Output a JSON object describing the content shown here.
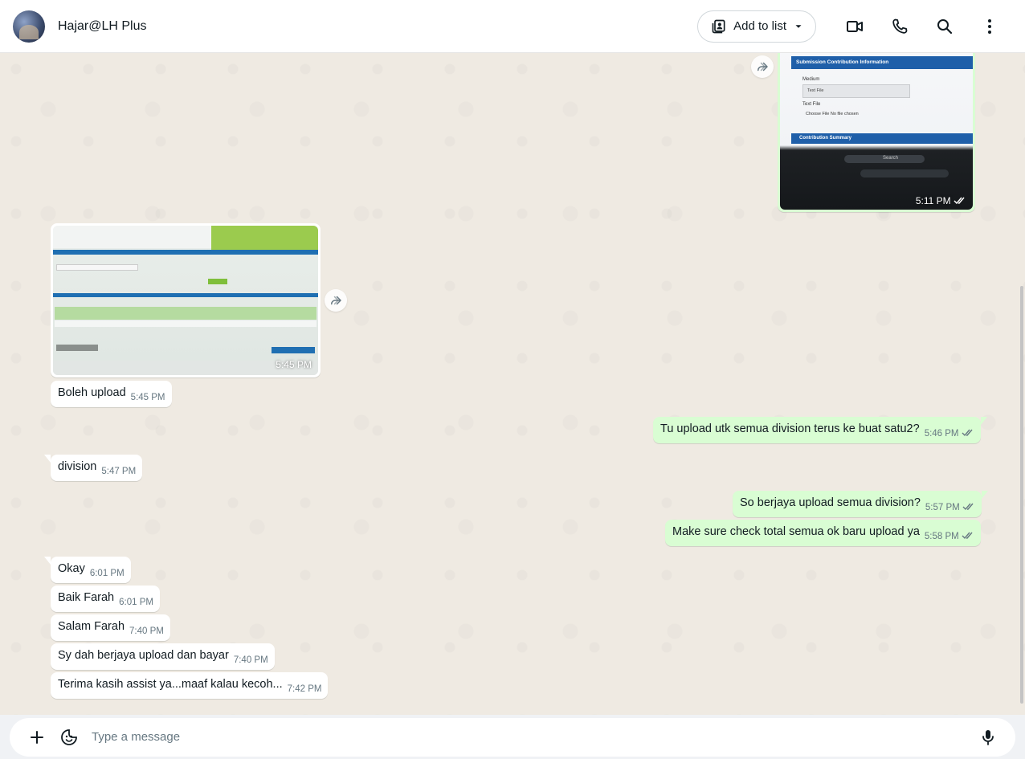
{
  "header": {
    "contact_name": "Hajar@LH Plus",
    "add_to_list_label": "Add to list",
    "icons": [
      "video-call-icon",
      "voice-call-icon",
      "search-icon",
      "menu-icon"
    ]
  },
  "images": {
    "sent_image_time": "5:11 PM",
    "received_image_time": "5:45 PM",
    "sent_image_lines": [
      "Submission Contribution Information",
      "Medium",
      "Text File",
      "Text File",
      "Choose File  No file chosen",
      "Contribution Summary",
      "Search"
    ]
  },
  "messages": [
    {
      "dir": "in",
      "text": "Boleh upload",
      "time": "5:45 PM"
    },
    {
      "dir": "out",
      "text": "Tu upload utk semua division terus ke buat satu2?",
      "time": "5:46 PM"
    },
    {
      "dir": "in",
      "text": "division",
      "time": "5:47 PM"
    },
    {
      "dir": "out",
      "text": "So berjaya upload semua division?",
      "time": "5:57 PM"
    },
    {
      "dir": "out",
      "text": "Make sure check total semua ok baru upload ya",
      "time": "5:58 PM"
    },
    {
      "dir": "in",
      "text": "Okay",
      "time": "6:01 PM"
    },
    {
      "dir": "in",
      "text": "Baik Farah",
      "time": "6:01 PM"
    },
    {
      "dir": "in",
      "text": "Salam Farah",
      "time": "7:40 PM"
    },
    {
      "dir": "in",
      "text": "Sy dah berjaya upload dan bayar",
      "time": "7:40 PM"
    },
    {
      "dir": "in",
      "text": "Terima kasih assist ya...maaf kalau kecoh...",
      "time": "7:42 PM"
    }
  ],
  "composer": {
    "placeholder": "Type a message"
  },
  "colors": {
    "chat_bg": "#efeae2",
    "incoming": "#ffffff",
    "outgoing": "#d9fdd3",
    "read_ticks": "#53bdeb"
  }
}
